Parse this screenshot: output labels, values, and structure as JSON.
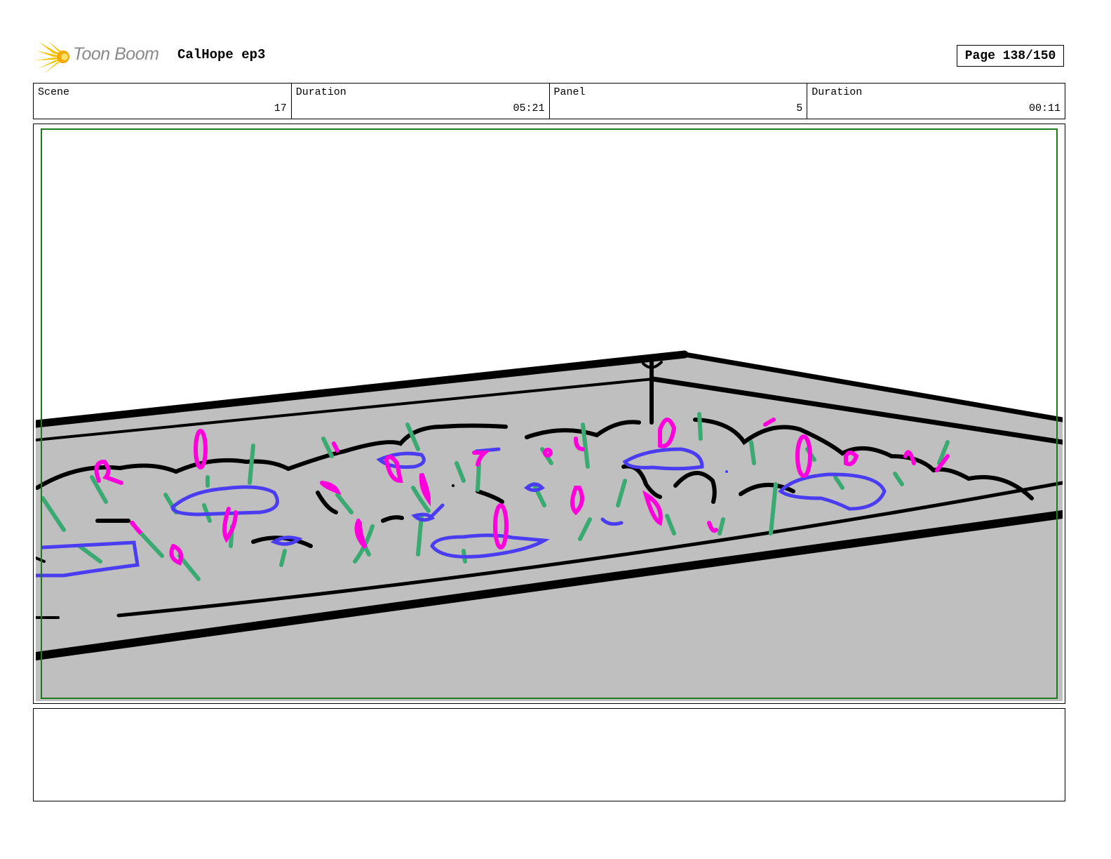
{
  "header": {
    "logo_text": "Toon Boom",
    "project_title": "CalHope ep3",
    "page_label": "Page 138/150"
  },
  "info": {
    "scene_label": "Scene",
    "scene_value": "17",
    "scene_duration_label": "Duration",
    "scene_duration_value": "05:21",
    "panel_label": "Panel",
    "panel_value": "5",
    "panel_duration_label": "Duration",
    "panel_duration_value": "00:11"
  },
  "panel": {
    "description": "",
    "colors": {
      "bed_fill": "#bfbfbf",
      "outline": "#000000",
      "foliage": "#3aaa72",
      "flowers": "#ff00dd",
      "rocks": "#4a3cf0",
      "safe_area": "#1e7a1e"
    }
  },
  "notes": {
    "text": ""
  }
}
